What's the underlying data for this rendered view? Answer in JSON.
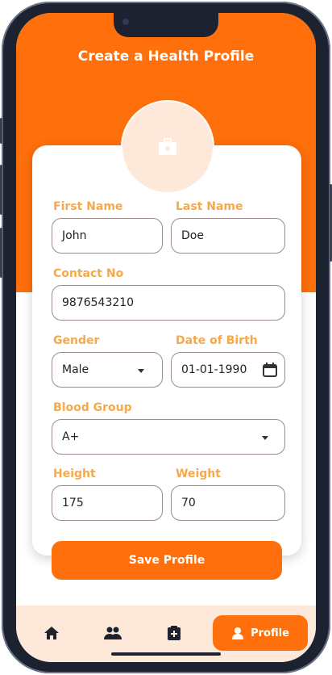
{
  "app": {
    "title": "Create a Health Profile"
  },
  "colors": {
    "accent": "#ff6f0b",
    "label": "#f7a94a",
    "soft": "#fde8d9"
  },
  "icons": {
    "avatar": "medical-briefcase-icon"
  },
  "form": {
    "first_name": {
      "label": "First Name",
      "value": "John"
    },
    "last_name": {
      "label": "Last Name",
      "value": "Doe"
    },
    "contact": {
      "label": "Contact No",
      "value": "9876543210"
    },
    "gender": {
      "label": "Gender",
      "value": "Male"
    },
    "dob": {
      "label": "Date of Birth",
      "value": "01-01-1990"
    },
    "blood_group": {
      "label": "Blood Group",
      "value": "A+"
    },
    "height": {
      "label": "Height",
      "value": "175"
    },
    "weight": {
      "label": "Weight",
      "value": "70"
    }
  },
  "actions": {
    "save_label": "Save Profile"
  },
  "nav": {
    "items": [
      {
        "icon": "home-icon"
      },
      {
        "icon": "people-icon"
      },
      {
        "icon": "medical-record-icon"
      },
      {
        "icon": "person-icon",
        "label": "Profile",
        "active": true
      }
    ]
  }
}
